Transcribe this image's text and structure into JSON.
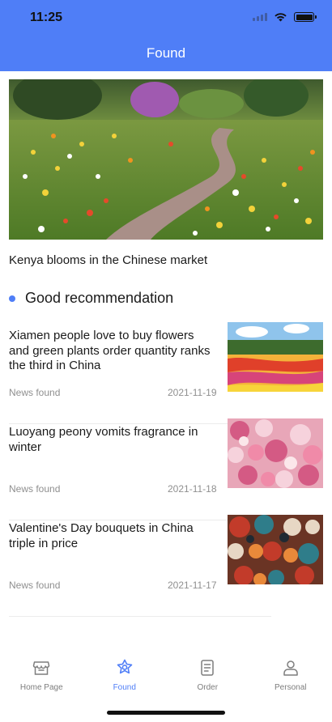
{
  "status_bar": {
    "time": "11:25"
  },
  "header": {
    "title": "Found"
  },
  "banner": {
    "caption": "Kenya blooms in the Chinese market"
  },
  "recommendation": {
    "title": "Good recommendation",
    "items": [
      {
        "title": "Xiamen people love to buy flowers and green plants order quantity ranks the third in China",
        "source": "News found",
        "date": "2021-11-19"
      },
      {
        "title": "Luoyang peony vomits fragrance in winter",
        "source": "News found",
        "date": "2021-11-18"
      },
      {
        "title": "Valentine's Day bouquets in China triple in price",
        "source": "News found",
        "date": "2021-11-17"
      }
    ]
  },
  "tabbar": {
    "tabs": [
      {
        "label": "Home Page",
        "icon": "storefront-icon",
        "active": false
      },
      {
        "label": "Found",
        "icon": "flower-icon",
        "active": true
      },
      {
        "label": "Order",
        "icon": "document-icon",
        "active": false
      },
      {
        "label": "Personal",
        "icon": "person-icon",
        "active": false
      }
    ]
  },
  "colors": {
    "accent": "#4f7ef7",
    "muted_text": "#8f8f8f",
    "divider": "#ececec"
  }
}
